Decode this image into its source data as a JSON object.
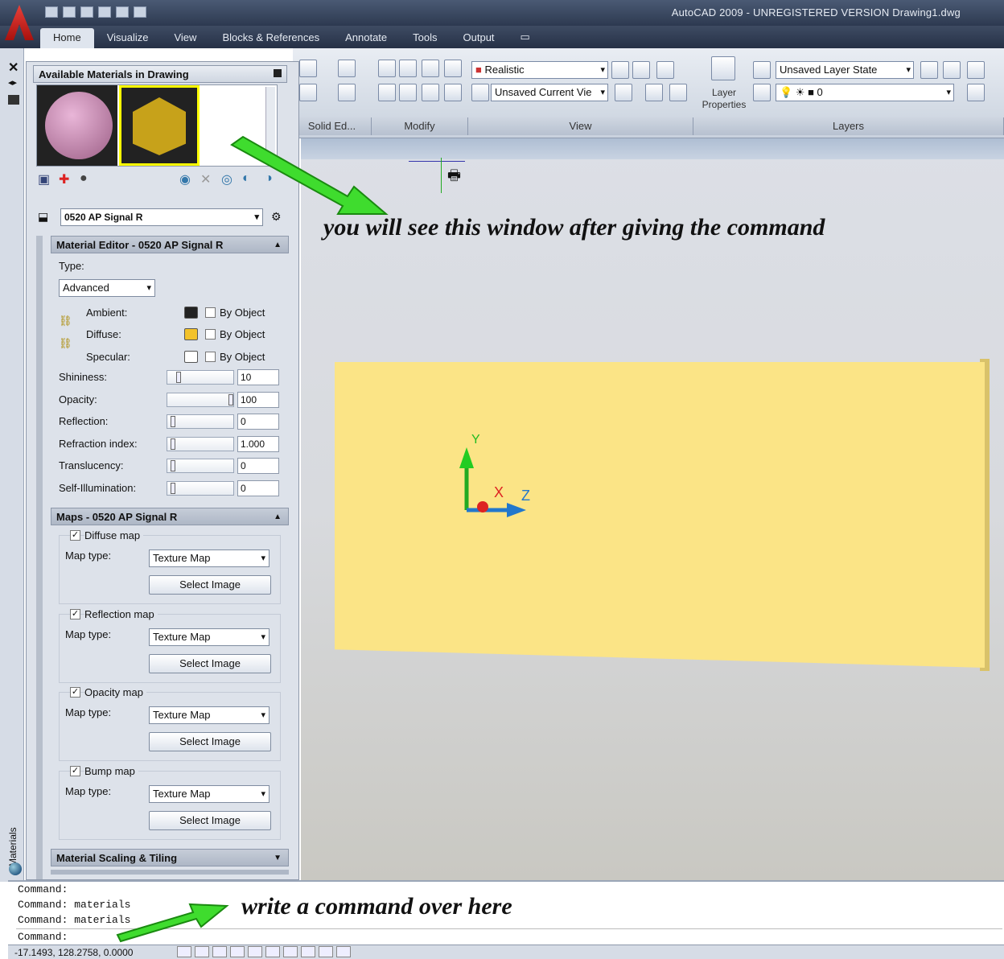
{
  "window": {
    "title": "AutoCAD 2009 - UNREGISTERED VERSION Drawing1.dwg"
  },
  "ribbon": {
    "tabs": [
      "Home",
      "Visualize",
      "View",
      "Blocks & References",
      "Annotate",
      "Tools",
      "Output"
    ],
    "active_tab": "Home",
    "panels": {
      "solid_editing": "Solid Ed...",
      "modify": "Modify",
      "view": "View",
      "layers": "Layers"
    },
    "visual_style": "Realistic",
    "view_name": "Unsaved Current Vie",
    "layer_state": "Unsaved Layer State",
    "current_layer": "0",
    "layer_properties_label": "Layer Properties"
  },
  "palette": {
    "vertical_title": "Materials",
    "available_header": "Available Materials in Drawing",
    "material_name": "0520 AP Signal R",
    "editor": {
      "header": "Material Editor - 0520 AP Signal R",
      "type_label": "Type:",
      "type_value": "Advanced",
      "ambient": "Ambient:",
      "diffuse": "Diffuse:",
      "specular": "Specular:",
      "by_object": "By Object",
      "colors": {
        "ambient": "#222222",
        "diffuse": "#f3c22a",
        "specular": "#ffffff"
      },
      "properties": [
        {
          "label": "Shininess:",
          "value": "10",
          "level": 0.1
        },
        {
          "label": "Opacity:",
          "value": "100",
          "level": 1.0
        },
        {
          "label": "Reflection:",
          "value": "0",
          "level": 0
        },
        {
          "label": "Refraction index:",
          "value": "1.000",
          "level": 0
        },
        {
          "label": "Translucency:",
          "value": "0",
          "level": 0
        },
        {
          "label": "Self-Illumination:",
          "value": "0",
          "level": 0
        }
      ]
    },
    "maps": {
      "header": "Maps - 0520 AP Signal R",
      "map_type_label": "Map type:",
      "groups": [
        {
          "name": "Diffuse map",
          "checked": true,
          "type": "Texture Map",
          "button": "Select Image"
        },
        {
          "name": "Reflection map",
          "checked": true,
          "type": "Texture Map",
          "button": "Select Image"
        },
        {
          "name": "Opacity map",
          "checked": true,
          "type": "Texture Map",
          "button": "Select Image"
        },
        {
          "name": "Bump map",
          "checked": true,
          "type": "Texture Map",
          "button": "Select Image"
        }
      ]
    },
    "scaling_header": "Material Scaling & Tiling"
  },
  "viewport": {
    "annotation_top": "you will see this window  after giving the command",
    "annotation_bottom": "write a command over here",
    "axis": {
      "x": "X",
      "y": "Y",
      "z": "Z"
    }
  },
  "command": {
    "lines": [
      "Command:",
      "Command: materials",
      "Command: materials",
      "Command:"
    ]
  },
  "status": {
    "coords": "-17.1493, 128.2758, 0.0000"
  }
}
